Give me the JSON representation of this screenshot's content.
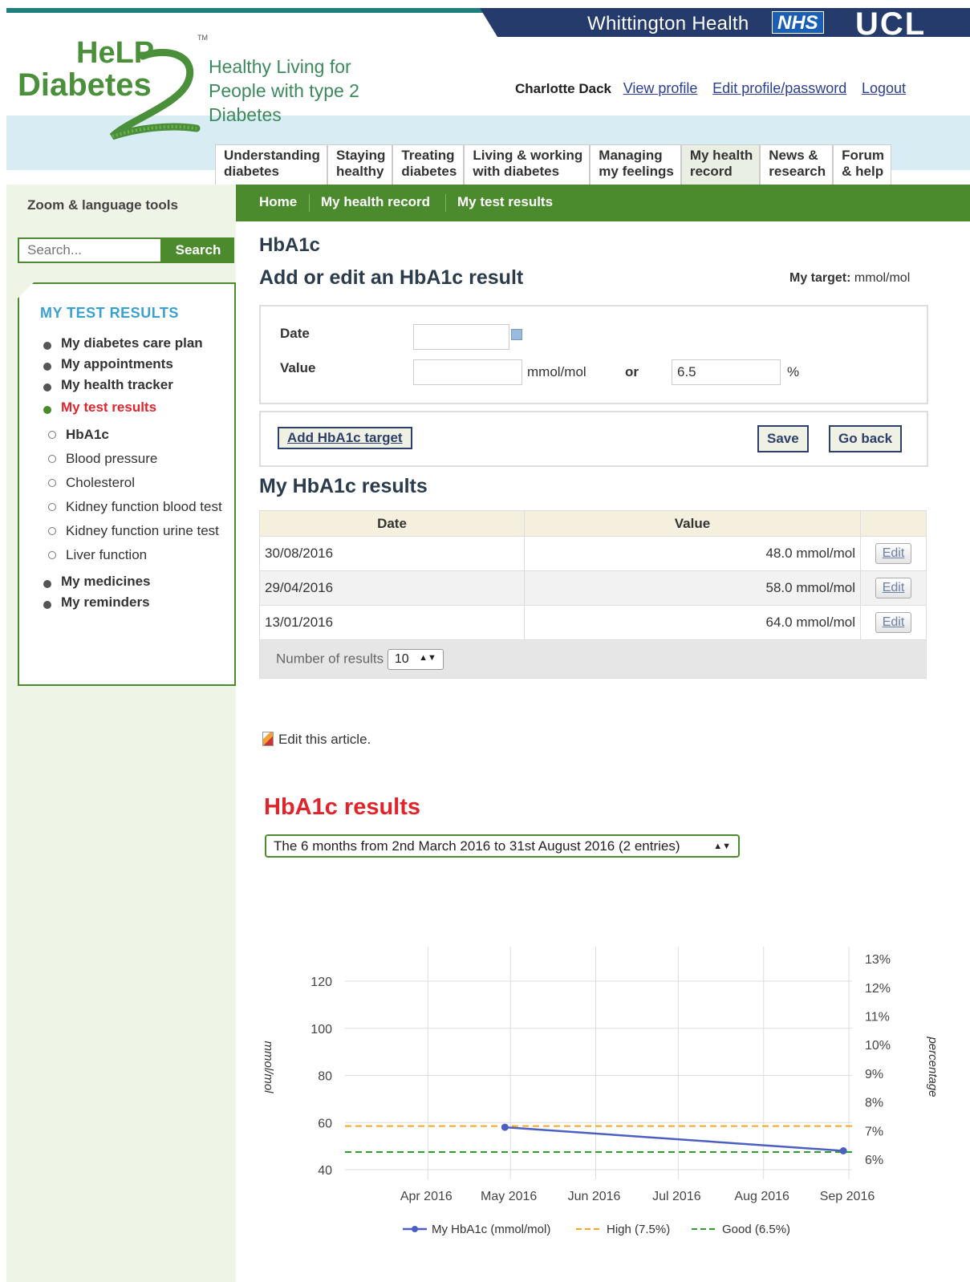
{
  "header": {
    "org_name": "Whittington Health",
    "nhs_badge": "NHS",
    "ucl_logo": "UCL",
    "logo_line1": "HeLP",
    "logo_line2": "Diabetes",
    "logo_tm": "TM",
    "tagline": "Healthy Living for People with type 2 Diabetes",
    "user_name": "Charlotte Dack",
    "links": [
      "View profile",
      "Edit profile/password",
      "Logout"
    ]
  },
  "main_nav": [
    {
      "line1": "Understanding",
      "line2": "diabetes"
    },
    {
      "line1": "Staying",
      "line2": "healthy"
    },
    {
      "line1": "Treating",
      "line2": "diabetes"
    },
    {
      "line1": "Living & working",
      "line2": "with diabetes"
    },
    {
      "line1": "Managing",
      "line2": "my feelings"
    },
    {
      "line1": "My health",
      "line2": "record",
      "active": true
    },
    {
      "line1": "News &",
      "line2": "research"
    },
    {
      "line1": "Forum",
      "line2": "& help"
    }
  ],
  "breadcrumb": [
    "Home",
    "My health record",
    "My test results"
  ],
  "sidebar": {
    "zoom_tools": "Zoom & language tools",
    "search_placeholder": "Search...",
    "search_button": "Search",
    "heading": "MY TEST RESULTS",
    "items": [
      {
        "label": "My diabetes care plan"
      },
      {
        "label": "My appointments"
      },
      {
        "label": "My health tracker"
      },
      {
        "label": "My test results",
        "current": true
      },
      {
        "label": "HbA1c",
        "sub": true,
        "current": true
      },
      {
        "label": "Blood pressure",
        "sub": true
      },
      {
        "label": "Cholesterol",
        "sub": true
      },
      {
        "label": "Kidney function blood test",
        "sub": true
      },
      {
        "label": "Kidney function urine test",
        "sub": true
      },
      {
        "label": "Liver function",
        "sub": true
      },
      {
        "label": "My medicines"
      },
      {
        "label": "My reminders"
      }
    ]
  },
  "page": {
    "title": "HbA1c",
    "form_title": "Add or edit an HbA1c result",
    "target_label": "My target:",
    "target_unit": "mmol/mol",
    "date_label": "Date",
    "date_value": "",
    "value_label": "Value",
    "mmol_value": "",
    "mmol_unit": "mmol/mol",
    "or_text": "or",
    "pct_value": "6.5",
    "pct_unit": "%",
    "add_target_button": "Add HbA1c target",
    "save_button": "Save",
    "go_back_button": "Go back",
    "results_title": "My HbA1c results"
  },
  "results_table": {
    "columns": [
      "Date",
      "Value"
    ],
    "rows": [
      {
        "date": "30/08/2016",
        "value": "48.0 mmol/mol",
        "action": "Edit"
      },
      {
        "date": "29/04/2016",
        "value": "58.0 mmol/mol",
        "action": "Edit"
      },
      {
        "date": "13/01/2016",
        "value": "64.0 mmol/mol",
        "action": "Edit"
      }
    ],
    "count_label": "Number of results",
    "count_value": "10"
  },
  "edit_article": "Edit this article.",
  "chart_section": {
    "title": "HbA1c results",
    "range_option": "The 6 months from 2nd March 2016 to 31st August 2016 (2 entries)"
  },
  "colors": {
    "brand_green": "#4c8a2e",
    "nav_navy": "#243b6b",
    "alert_red": "#e0242c",
    "series_blue": "#4a5fc1",
    "high_orange": "#f5a623",
    "good_green": "#2ca02c"
  },
  "chart_data": {
    "type": "line",
    "title": "",
    "ylabel": "mmol/mol",
    "y2label": "percentage",
    "ylim": [
      40,
      120
    ],
    "yticks": [
      40,
      60,
      80,
      100,
      120
    ],
    "y2ticks": [
      "6%",
      "7%",
      "8%",
      "9%",
      "10%",
      "11%",
      "12%",
      "13%"
    ],
    "xticks": [
      "Apr 2016",
      "May 2016",
      "Jun 2016",
      "Jul 2016",
      "Aug 2016",
      "Sep 2016"
    ],
    "grid": true,
    "legend_position": "bottom",
    "series": [
      {
        "name": "My HbA1c (mmol/mol)",
        "style": "solid-markers",
        "points": [
          {
            "x": "2016-04-29",
            "y": 58
          },
          {
            "x": "2016-08-30",
            "y": 48
          }
        ]
      },
      {
        "name": "High (7.5%)",
        "style": "dashed",
        "y": 58.5
      },
      {
        "name": "Good (6.5%)",
        "style": "dashed",
        "y": 47.5
      }
    ]
  }
}
